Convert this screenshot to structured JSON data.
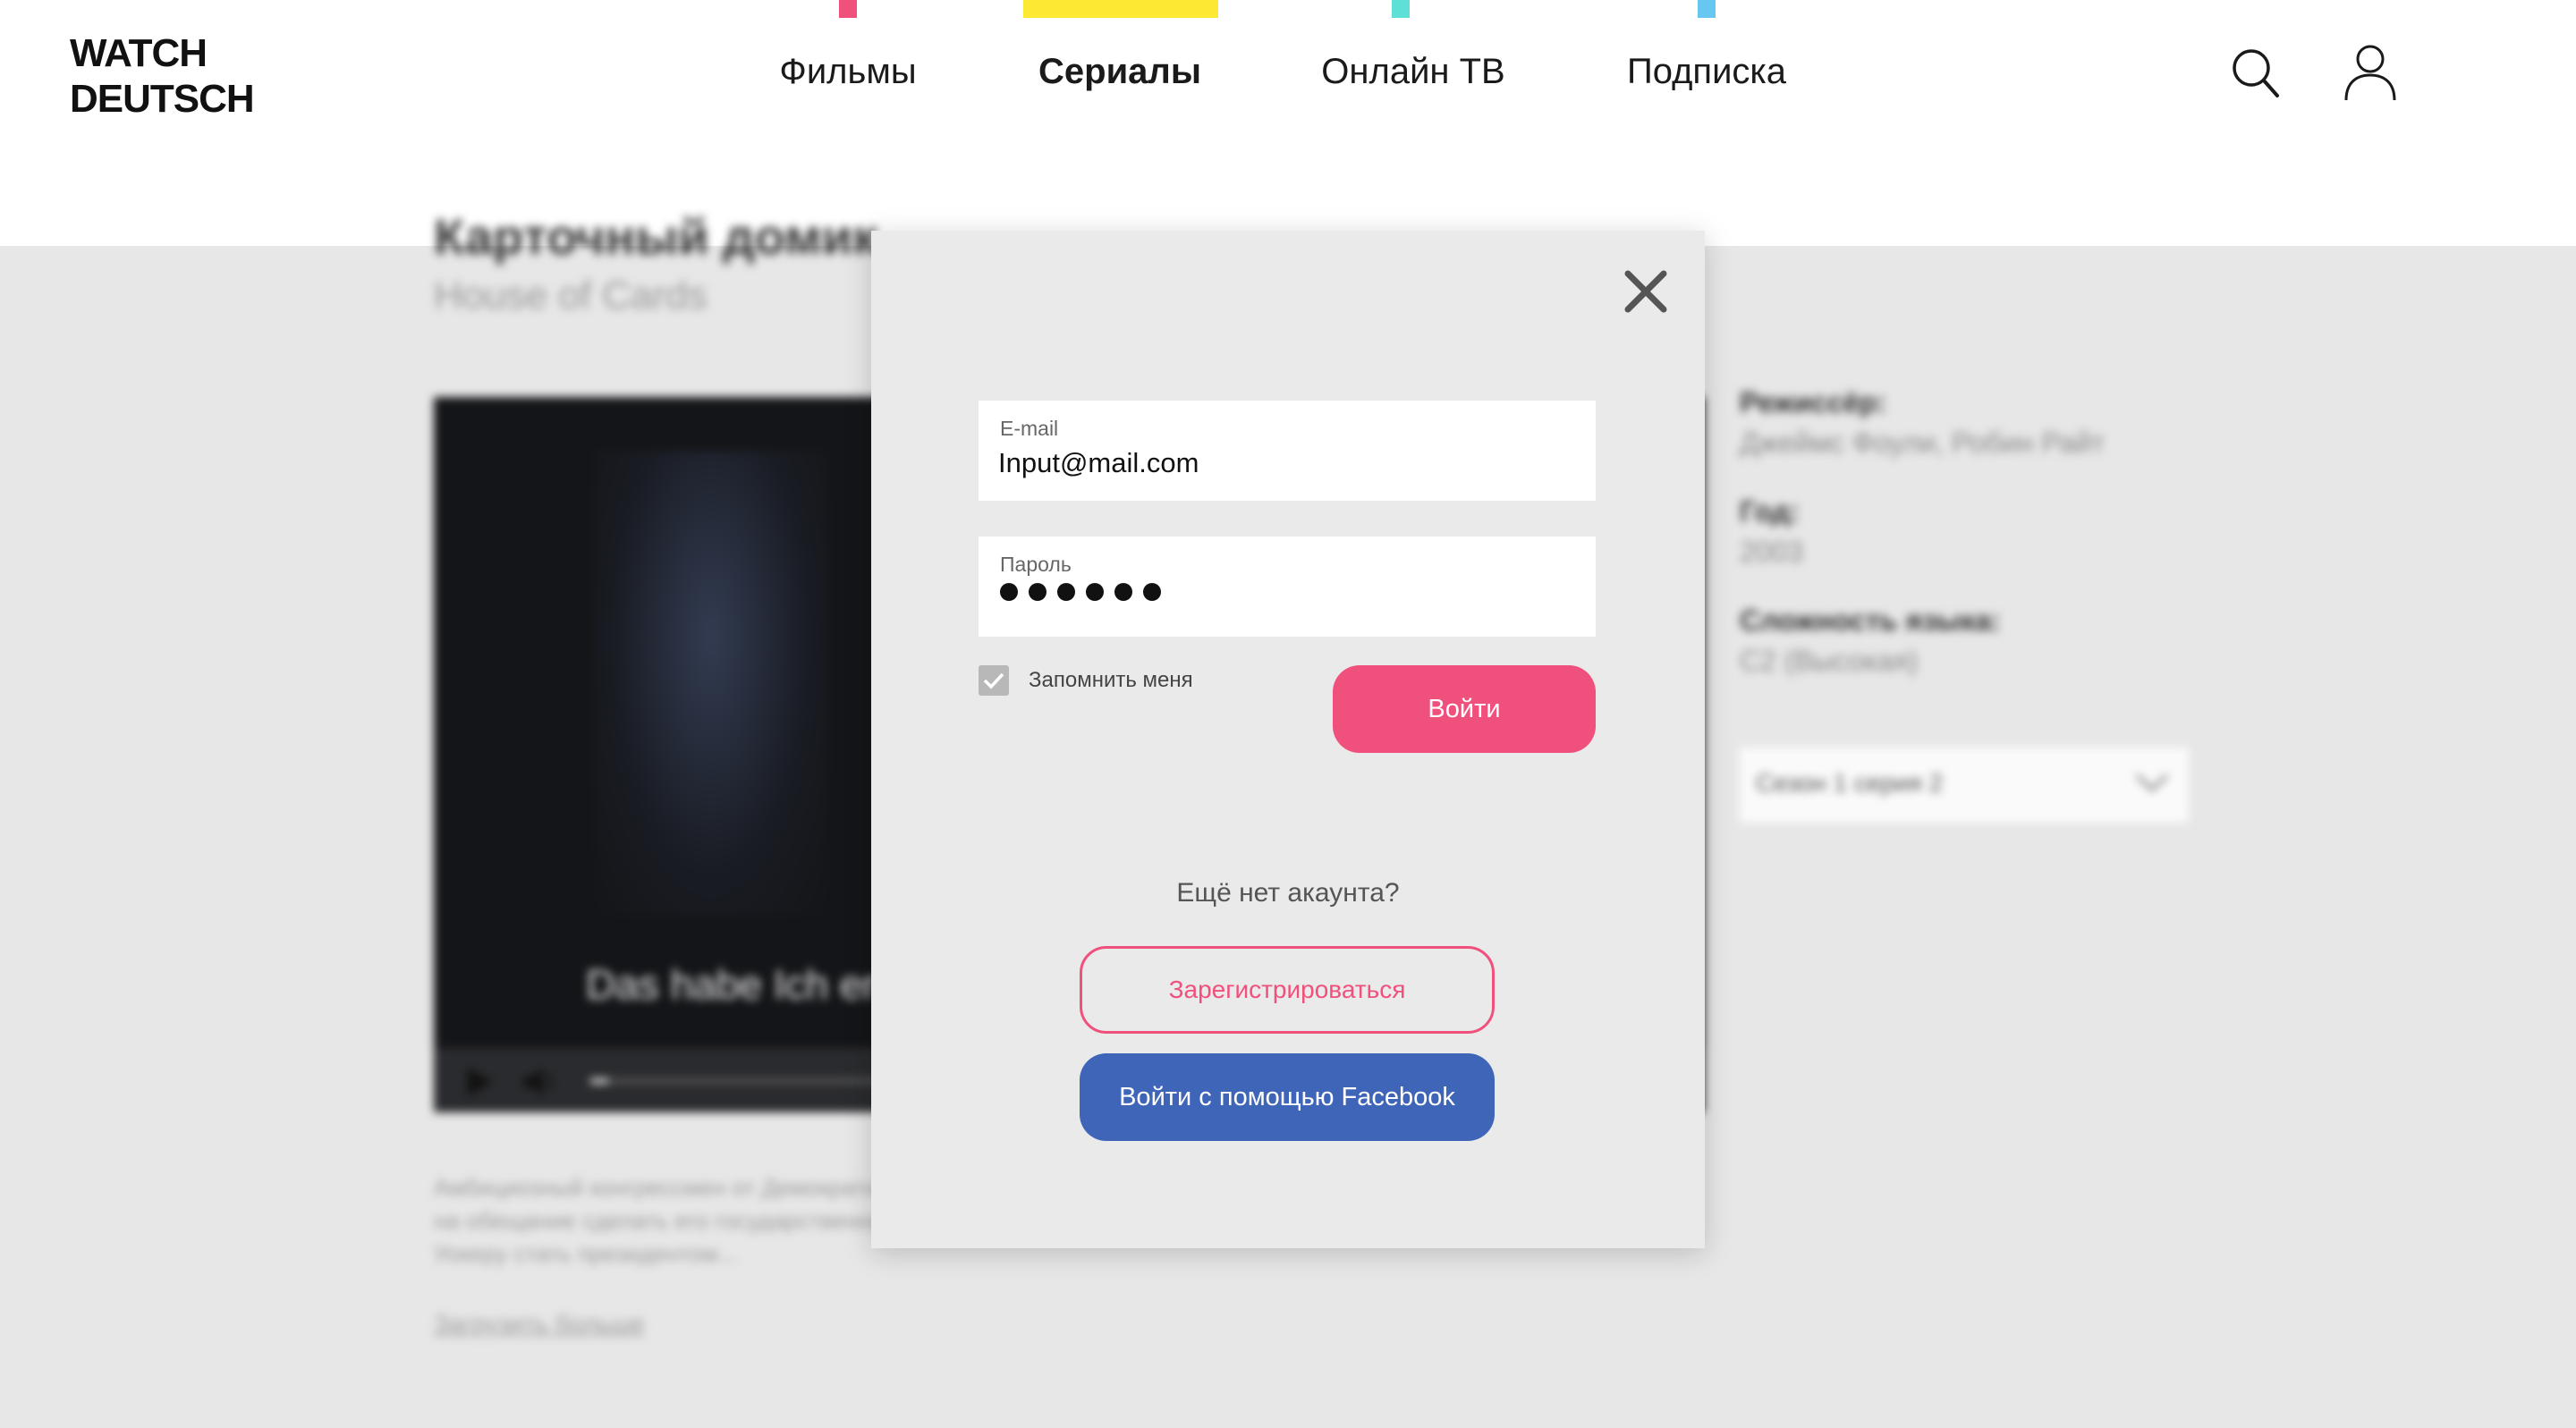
{
  "header": {
    "logo_line1": "WATCH",
    "logo_line2": "DEUTSCH",
    "nav": [
      {
        "label": "Фильмы",
        "accent": "#f0507c",
        "active": false
      },
      {
        "label": "Сериалы",
        "accent": "#fde933",
        "active": true
      },
      {
        "label": "Онлайн ТВ",
        "accent": "#5ee0d6",
        "active": false
      },
      {
        "label": "Подписка",
        "accent": "#67c7f0",
        "active": false
      }
    ],
    "icons": [
      "search-icon",
      "user-icon"
    ]
  },
  "background_page": {
    "title": "Карточный домик",
    "subtitle": "House of Cards",
    "player": {
      "subtitle_text": "Das habe Ich er",
      "progress": 0.05,
      "icons": [
        "play-icon",
        "volume-icon"
      ]
    },
    "description": "Амбициозный конгрессмен от Демократической партии Фрэнк Андервуд в обмен на обещание сделать его государственным секретарём США помогает Гаррету Уокеру стать президентом...",
    "load_more": "Загрузить больше",
    "info": {
      "director_label": "Режиссёр:",
      "director_value": "Джеймс Фоули, Робин Райт",
      "year_label": "Год:",
      "year_value": "2003",
      "difficulty_label": "Сложность языка:",
      "difficulty_value": "С2 (Высокая)"
    },
    "season_select": "Сезон 1 серия 2"
  },
  "login_modal": {
    "email_label": "E-mail",
    "email_value": "Input@mail.com",
    "password_label": "Пароль",
    "password_length": 6,
    "remember_label": "Запомнить меня",
    "remember_checked": true,
    "login_button": "Войти",
    "no_account_text": "Ещё нет акаунта?",
    "register_button": "Зарегистрироваться",
    "facebook_button": "Войти с помощью Facebook"
  },
  "colors": {
    "primary_pink": "#f0507c",
    "facebook_blue": "#3e65b8",
    "overlay_gray": "#e7e7e7",
    "modal_bg": "#eaeaea"
  }
}
